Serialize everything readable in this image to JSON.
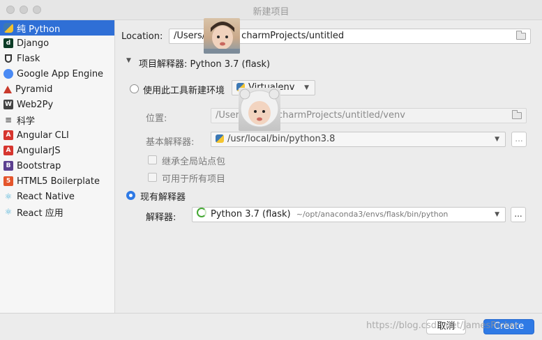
{
  "window": {
    "title": "新建项目",
    "buttons": [
      "close",
      "minimize",
      "zoom"
    ]
  },
  "sidebar": {
    "items": [
      {
        "label": "纯 Python",
        "icon": "python-icon",
        "selected": true,
        "icon_color": "#f2c12e"
      },
      {
        "label": "Django",
        "icon": "django-icon",
        "icon_color": "#0c3c26"
      },
      {
        "label": "Flask",
        "icon": "flask-icon",
        "icon_color": "#333333"
      },
      {
        "label": "Google App Engine",
        "icon": "google-app-engine-icon",
        "icon_color": "#4a8af4"
      },
      {
        "label": "Pyramid",
        "icon": "pyramid-icon",
        "icon_color": "#c9392b"
      },
      {
        "label": "Web2Py",
        "icon": "web2py-icon",
        "icon_color": "#444444"
      },
      {
        "label": "科学",
        "icon": "scientific-icon",
        "icon_color": "#555555"
      },
      {
        "label": "Angular CLI",
        "icon": "angular-icon",
        "icon_color": "#d6352e"
      },
      {
        "label": "AngularJS",
        "icon": "angularjs-icon",
        "icon_color": "#d6352e"
      },
      {
        "label": "Bootstrap",
        "icon": "bootstrap-icon",
        "icon_color": "#5b3f8f"
      },
      {
        "label": "HTML5 Boilerplate",
        "icon": "html5-icon",
        "icon_color": "#e4552b"
      },
      {
        "label": "React Native",
        "icon": "react-icon",
        "icon_color": "#4fb3d9"
      },
      {
        "label": "React 应用",
        "icon": "react-icon",
        "icon_color": "#4fb3d9"
      }
    ]
  },
  "main": {
    "location_label": "Location:",
    "location_value": "/Users/",
    "location_value_tail": "charmProjects/untitled",
    "interpreter_section": "项目解释器: Python 3.7 (flask)",
    "new_env": {
      "label": "使用此工具新建环境",
      "tool": "Virtualenv",
      "location_label": "位置:",
      "location_value": "/User",
      "location_value_tail": "charmProjects/untitled/venv",
      "base_label": "基本解释器:",
      "base_value": "/usr/local/bin/python3.8",
      "inherit_label": "继承全局站点包",
      "available_label": "可用于所有项目"
    },
    "existing": {
      "label": "现有解释器",
      "interp_label": "解释器:",
      "interp_name": "Python 3.7 (flask)",
      "interp_path": "~/opt/anaconda3/envs/flask/bin/python"
    },
    "browse_label": "..."
  },
  "footer": {
    "cancel_label": "取消",
    "create_label": "Create",
    "watermark": "https://blog.csdn.net/JamesRicker"
  },
  "colors": {
    "accent": "#2f7ae5",
    "selection": "#2f6fd6"
  }
}
